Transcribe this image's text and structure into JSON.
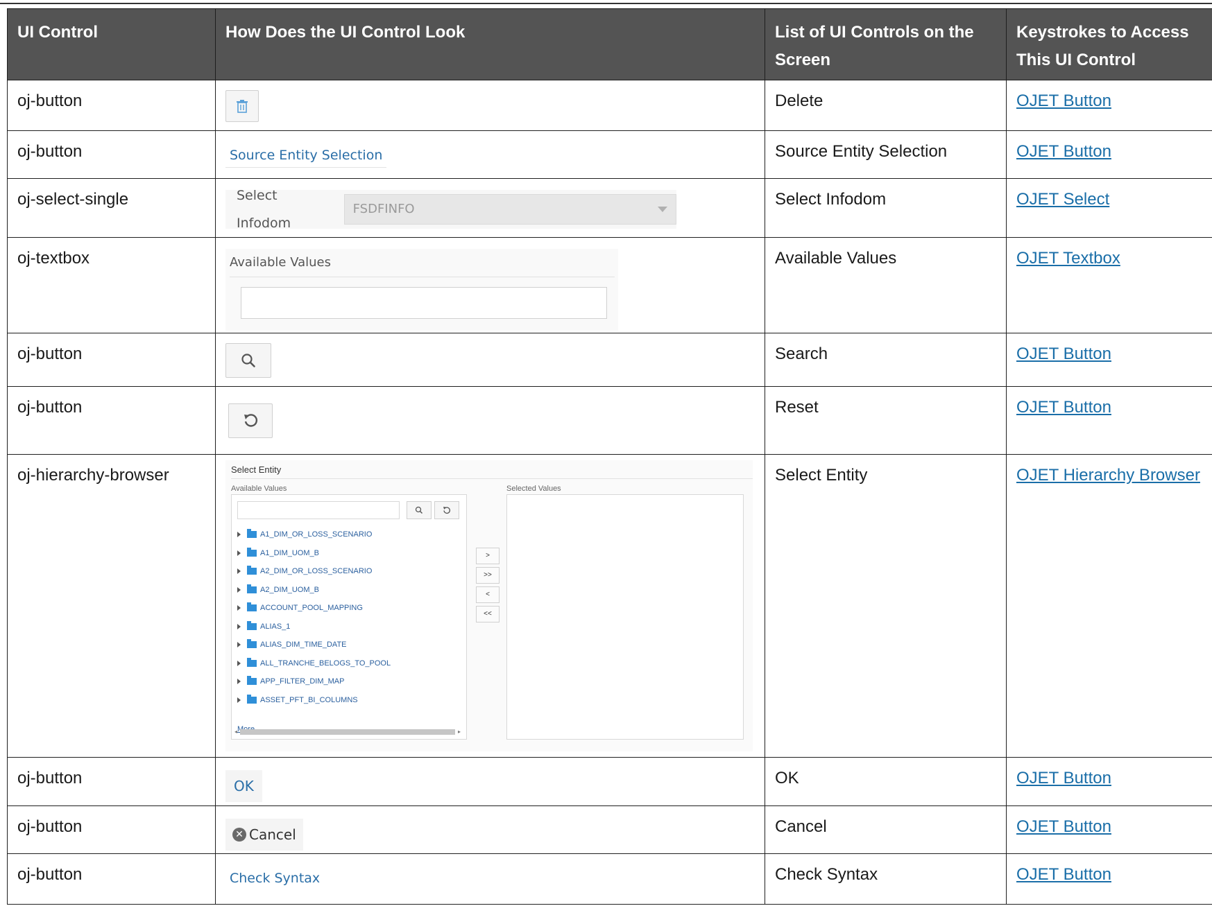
{
  "headers": {
    "ui_control": "UI Control",
    "how_look": "How Does the UI Control Look",
    "list_controls": "List of UI Controls on the Screen",
    "keystrokes": "Keystrokes to Access This UI Control"
  },
  "rows": [
    {
      "control": "oj-button",
      "name": "Delete",
      "link": "OJET Button"
    },
    {
      "control": "oj-button",
      "name": "Source Entity Selection",
      "link": "OJET Button",
      "look_text": "Source Entity Selection"
    },
    {
      "control": "oj-select-single",
      "name": "Select Infodom",
      "link": "OJET Select",
      "look_label": "Select Infodom",
      "look_value": "FSDFINFO"
    },
    {
      "control": "oj-textbox",
      "name": "Available Values",
      "link": "OJET Textbox",
      "look_label": "Available Values"
    },
    {
      "control": "oj-button",
      "name": "Search",
      "link": "OJET Button"
    },
    {
      "control": "oj-button",
      "name": "Reset",
      "link": "OJET Button"
    },
    {
      "control": "oj-hierarchy-browser",
      "name": "Select Entity",
      "link": "OJET Hierarchy Browser"
    },
    {
      "control": "oj-button",
      "name": "OK",
      "link": "OJET Button",
      "look_text": "OK"
    },
    {
      "control": "oj-button",
      "name": "Cancel",
      "link": "OJET Button",
      "look_text": "Cancel"
    },
    {
      "control": "oj-button",
      "name": "Check Syntax",
      "link": "OJET Button",
      "look_text": "Check Syntax"
    }
  ],
  "hierarchy_browser": {
    "title": "Select Entity",
    "available_label": "Available Values",
    "selected_label": "Selected Values",
    "items": [
      "A1_DIM_OR_LOSS_SCENARIO",
      "A1_DIM_UOM_B",
      "A2_DIM_OR_LOSS_SCENARIO",
      "A2_DIM_UOM_B",
      "ACCOUNT_POOL_MAPPING",
      "ALIAS_1",
      "ALIAS_DIM_TIME_DATE",
      "ALL_TRANCHE_BELOGS_TO_POOL",
      "APP_FILTER_DIM_MAP",
      "ASSET_PFT_BI_COLUMNS"
    ],
    "more": "More",
    "move_buttons": [
      ">",
      ">>",
      "<",
      "<<"
    ]
  },
  "icons": [
    "trash-icon",
    "search-icon",
    "reset-icon",
    "close-circle-icon",
    "folder-icon",
    "caret-right-icon"
  ],
  "colors": {
    "header_bg": "#545454",
    "link": "#1a6ea8",
    "widget_link": "#2a6ea7",
    "folder": "#2f8fd8"
  }
}
